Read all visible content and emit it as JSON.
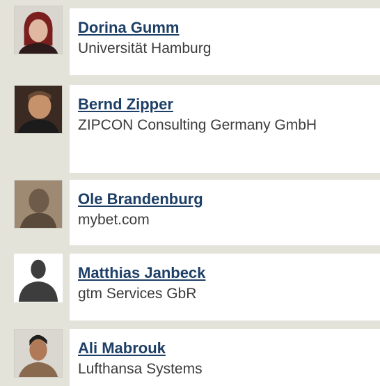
{
  "people": [
    {
      "name": "Dorina Gumm",
      "organization": "Universität Hamburg",
      "avatar_icon": "person-photo-icon"
    },
    {
      "name": "Bernd Zipper",
      "organization": "ZIPCON Consulting Germany GmbH",
      "avatar_icon": "person-photo-icon"
    },
    {
      "name": "Ole Brandenburg",
      "organization": "mybet.com",
      "avatar_icon": "person-photo-icon"
    },
    {
      "name": "Matthias Janbeck",
      "organization": "gtm Services GbR",
      "avatar_icon": "silhouette-placeholder-icon"
    },
    {
      "name": "Ali Mabrouk",
      "organization": "Lufthansa Systems",
      "avatar_icon": "person-photo-icon"
    }
  ],
  "colors": {
    "background": "#e4e3da",
    "card": "#ffffff",
    "link": "#1d3f66",
    "text": "#3b3b3b"
  }
}
